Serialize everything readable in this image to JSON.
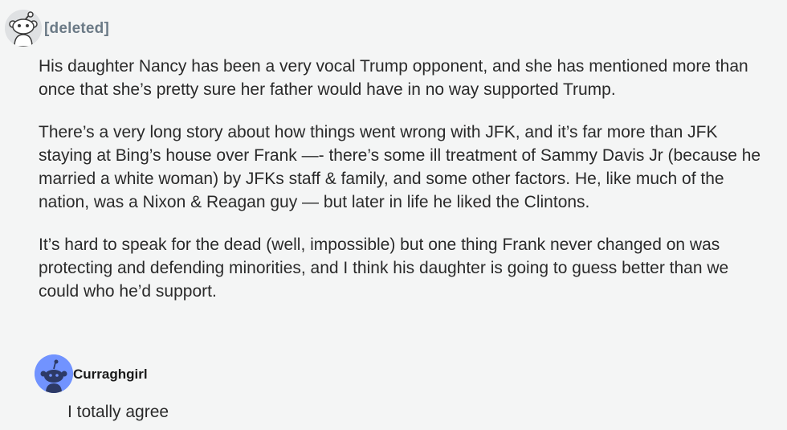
{
  "comments": [
    {
      "username": "[deleted]",
      "avatar_icon": "snoo-avatar-icon",
      "avatar_color": "#dfe1e3",
      "paragraphs": [
        "His daughter Nancy has been a very vocal Trump opponent, and she has mentioned more than once that she’s pretty sure her father would have in no way supported Trump.",
        "There’s a very long story about how things went wrong with JFK, and it’s far more than JFK staying at Bing’s house over Frank —- there’s some ill treatment of Sammy Davis Jr (because he married a white woman) by JFKs staff & family, and some other factors. He, like much of the nation, was a Nixon & Reagan guy — but later in life he liked the Clintons.",
        "It’s hard to speak for the dead (well, impossible) but one thing Frank never changed on was protecting and defending minorities, and I think his daughter is going to guess better than we could who he’d support."
      ]
    },
    {
      "username": "Curraghgirl",
      "avatar_icon": "snoo-avatar-icon",
      "avatar_color": "#7193ff",
      "text": "I totally agree"
    }
  ]
}
